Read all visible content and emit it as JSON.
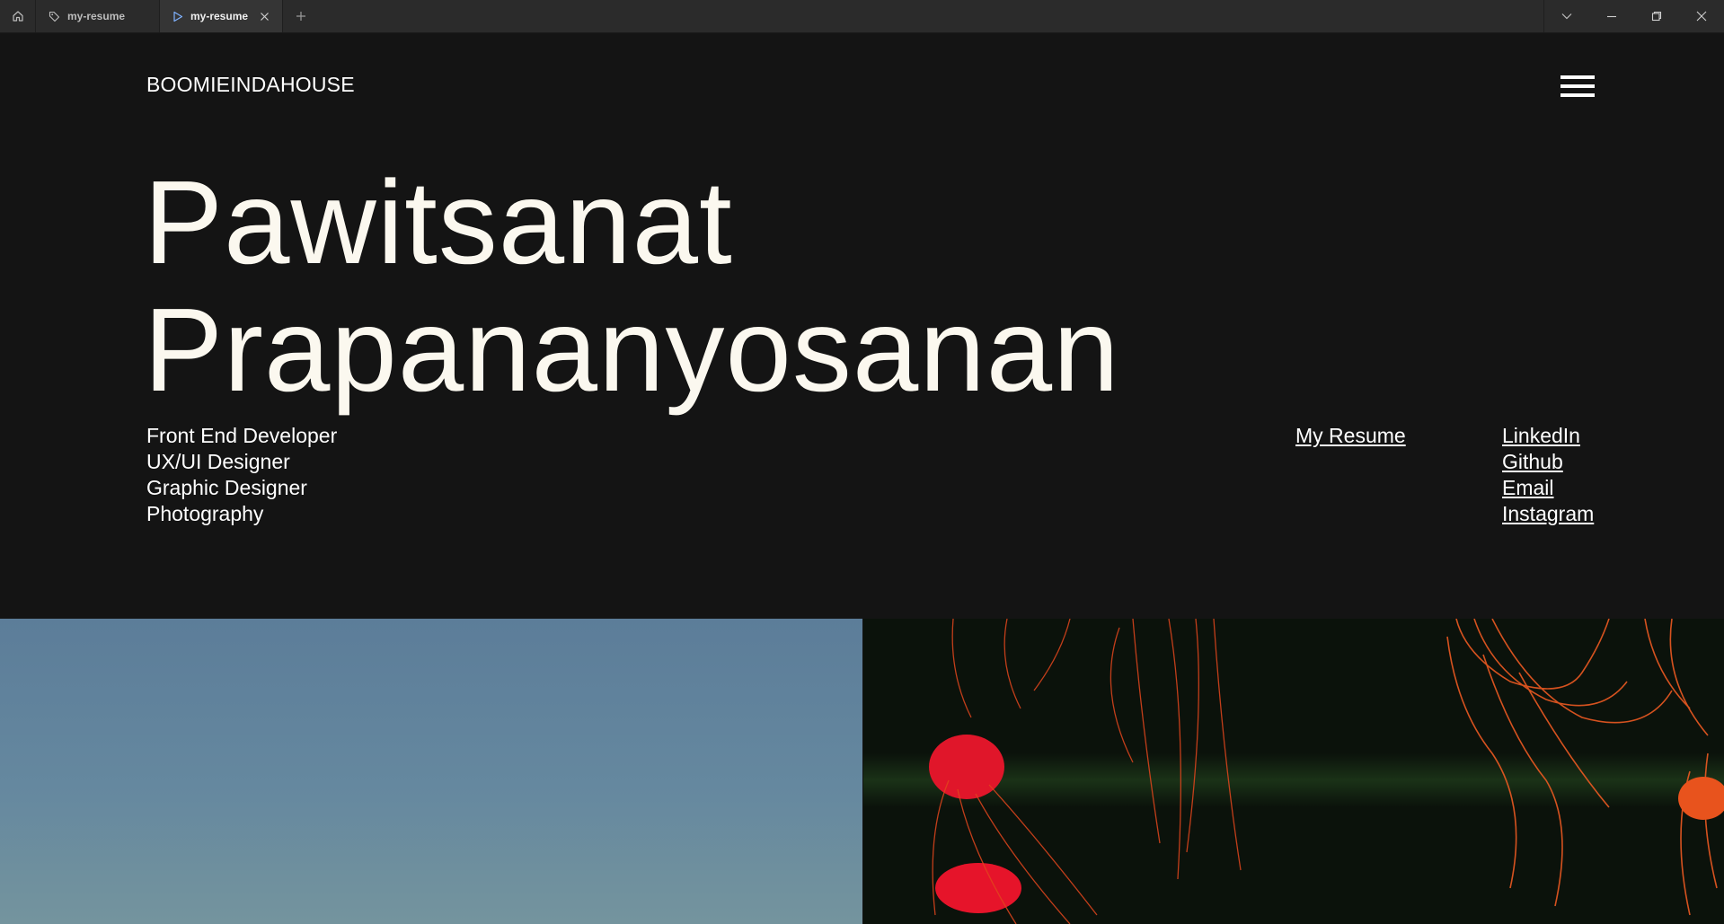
{
  "browser": {
    "tabs": [
      {
        "label": "my-resume"
      },
      {
        "label": "my-resume"
      }
    ]
  },
  "site": {
    "brand": "BOOMIEINDAHOUSE",
    "name_line1": "Pawitsanat",
    "name_line2": "Prapananyosanan",
    "roles": [
      "Front End Developer",
      "UX/UI Designer",
      "Graphic Designer",
      "Photography"
    ],
    "resume_link": "My Resume",
    "social_links": [
      "LinkedIn",
      "Github",
      "Email",
      "Instagram"
    ]
  },
  "icons": {
    "home": "home-icon",
    "tab1": "tag-icon",
    "tab2": "play-icon",
    "close": "close-icon",
    "new_tab": "plus-icon",
    "dropdown": "chevron-down-icon",
    "minimize": "minimize-icon",
    "maximize": "restore-icon",
    "window_close": "close-icon",
    "menu": "hamburger-icon"
  },
  "colors": {
    "page_bg": "#141414",
    "text": "#fbf8ef",
    "titlebar": "#2b2b2b"
  }
}
